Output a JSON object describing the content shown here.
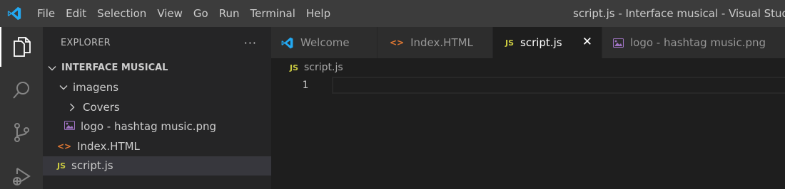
{
  "titlebar": {
    "menu": [
      "File",
      "Edit",
      "Selection",
      "View",
      "Go",
      "Run",
      "Terminal",
      "Help"
    ],
    "window_title": "script.js - Interface musical - Visual Studio Co",
    "logo_color": "#23a9f2"
  },
  "activitybar": {
    "items": [
      "explorer-icon",
      "search-icon",
      "source-control-icon",
      "run-debug-icon"
    ]
  },
  "explorer": {
    "title": "EXPLORER",
    "more": "···",
    "project": "INTERFACE MUSICAL",
    "tree": {
      "folder": "imagens",
      "subfolder": "Covers",
      "image_file": "logo - hashtag music.png",
      "html_file": "Index.HTML",
      "js_file": "script.js"
    }
  },
  "tabs": [
    {
      "label": "Welcome",
      "icon": "vscode-icon"
    },
    {
      "label": "Index.HTML",
      "icon": "html-icon"
    },
    {
      "label": "script.js",
      "icon": "js-icon",
      "active": true
    },
    {
      "label": "logo - hashtag music.png",
      "icon": "image-icon"
    }
  ],
  "icons": {
    "js": "JS",
    "html": "<>",
    "close": "✕"
  },
  "editor": {
    "breadcrumb": "script.js",
    "lines": [
      "1"
    ]
  },
  "colors": {
    "accent_js": "#cbcb41",
    "accent_html": "#e37933",
    "image_icon": "#a074c4"
  }
}
